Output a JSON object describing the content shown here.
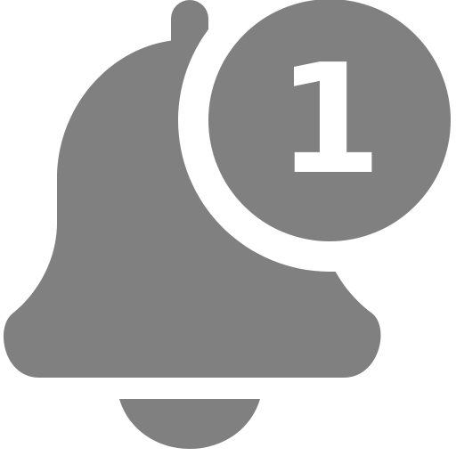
{
  "icon": {
    "name": "notification-bell-icon",
    "color": "#808080",
    "background": "#ffffff"
  },
  "badge": {
    "count": "1",
    "color": "#808080",
    "glyph_color": "#ffffff"
  }
}
